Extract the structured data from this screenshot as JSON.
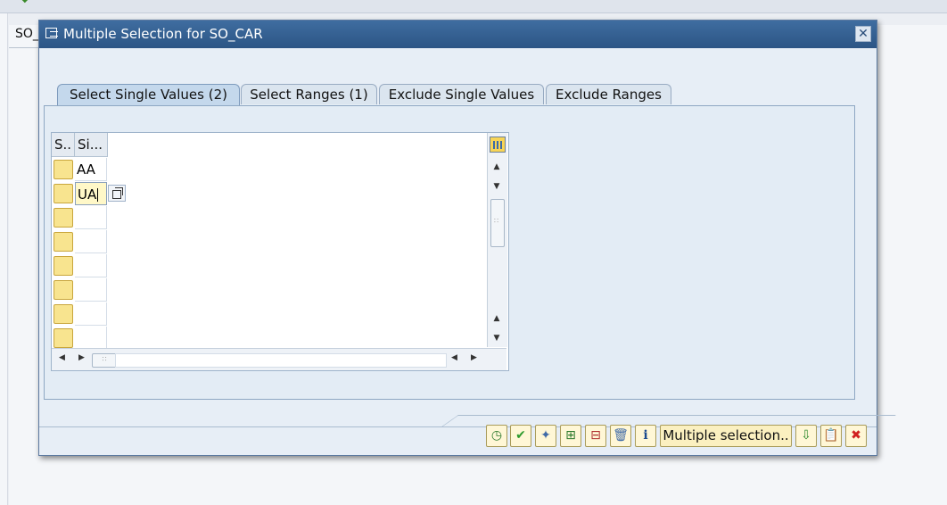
{
  "background": {
    "field_label": "SO_"
  },
  "dialog": {
    "title": "Multiple Selection for SO_CAR",
    "close_symbol": "✕"
  },
  "tabs": [
    {
      "label": "Select Single Values (2)",
      "active": true
    },
    {
      "label": "Select Ranges (1)",
      "active": false
    },
    {
      "label": "Exclude Single Values",
      "active": false
    },
    {
      "label": "Exclude Ranges",
      "active": false
    }
  ],
  "grid": {
    "headers": [
      "S..",
      "Si..."
    ],
    "rows": [
      "AA",
      "UA",
      "",
      "",
      "",
      "",
      "",
      ""
    ],
    "editing_row": 1
  },
  "toolbar": {
    "multiple_selection_label": "Multiple selection.."
  },
  "colors": {
    "title_bar": "#2c5585",
    "selector_cell": "#f8e48f",
    "dialog_bg": "#e7eef6"
  }
}
